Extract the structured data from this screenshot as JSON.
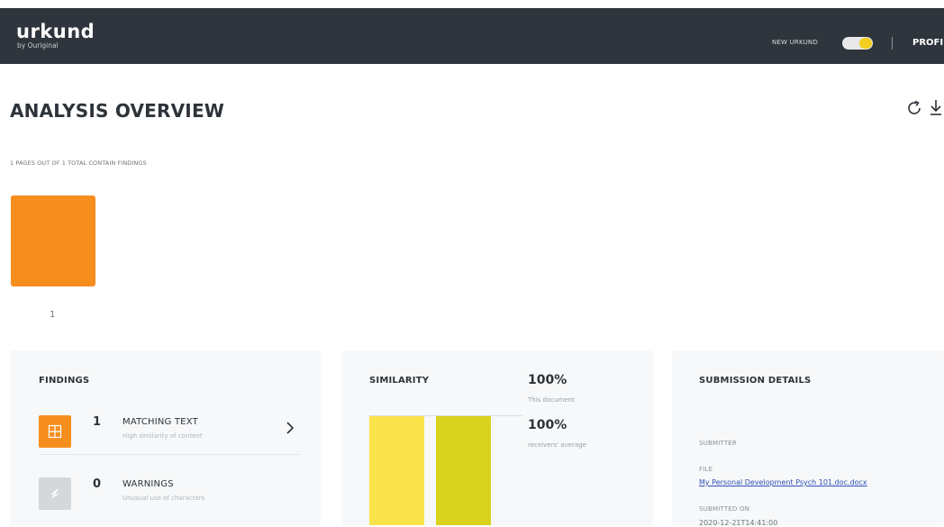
{
  "header": {
    "logo_main": "urkund",
    "logo_sub": "by Ouriginal",
    "toggle_label": "NEW URKUND",
    "toggle_on": true,
    "profile_label": "PROFILE"
  },
  "overview": {
    "title": "ANALYSIS OVERVIEW",
    "pages_info": "1 PAGES OUT OF 1 TOTAL CONTAIN FINDINGS",
    "pages": [
      {
        "number": "1",
        "color": "#f68e1e"
      }
    ]
  },
  "findings": {
    "title": "FINDINGS",
    "items": [
      {
        "count": "1",
        "label": "MATCHING TEXT",
        "subtitle": "High similarity of content",
        "icon": "document-grid-icon"
      },
      {
        "count": "0",
        "label": "WARNINGS",
        "subtitle": "Unusual use of characters",
        "icon": "warning-icon"
      }
    ]
  },
  "similarity": {
    "title": "SIMILARITY",
    "document_value": "100%",
    "document_caption": "This document",
    "average_value": "100%",
    "average_caption": "receivers' average",
    "colors": {
      "document": "#fbe44b",
      "average": "#d9d21f"
    }
  },
  "submission": {
    "title": "SUBMISSION DETAILS",
    "submitter_label": "SUBMITTER",
    "file_label": "FILE",
    "file_name": "My Personal Development Psych 101.doc.docx",
    "submitted_label": "SUBMITTED ON",
    "submitted_value": "2020-12-21T14:41:00"
  },
  "colors": {
    "topbar": "#2f353c",
    "accent_orange": "#f68e1e",
    "toggle_knob": "#f2cf1d",
    "link": "#2d4fb8"
  }
}
